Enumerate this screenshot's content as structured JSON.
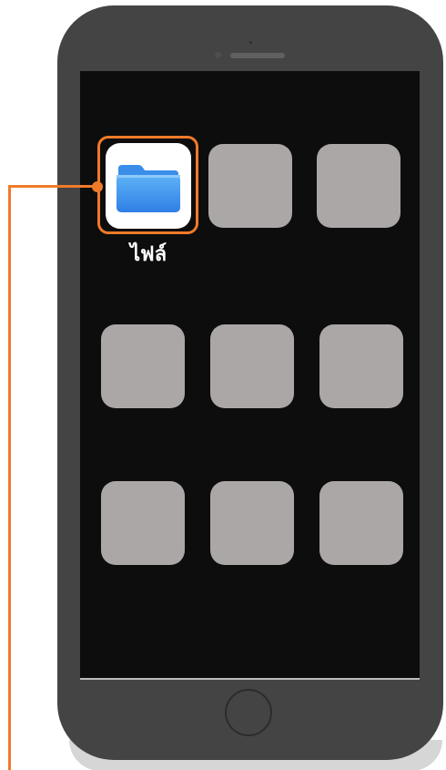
{
  "home_screen": {
    "highlighted_app": {
      "label": "ไฟล์",
      "icon": "folder-icon"
    },
    "placeholder_count": 8
  },
  "colors": {
    "callout": "#f07a2a",
    "phone_body": "#444444",
    "screen": "#0d0d0d",
    "placeholder_tile": "#aba7a6",
    "folder_light": "#5fb3f6",
    "folder_dark": "#2f7fe6"
  }
}
